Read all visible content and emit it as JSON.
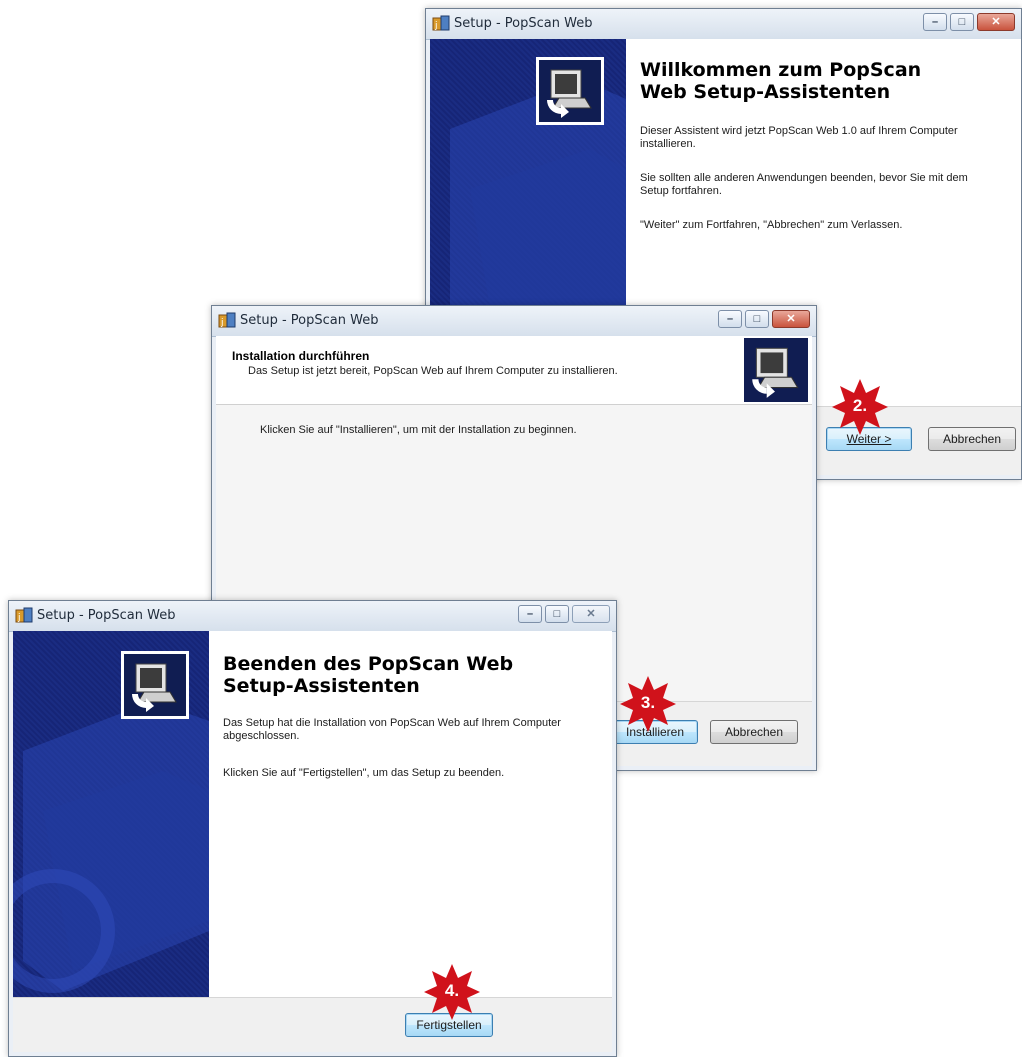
{
  "windows": {
    "welcome": {
      "title": "Setup - PopScan Web",
      "heading": "Willkommen zum PopScan Web Setup-Assistenten",
      "paragraphs": [
        "Dieser Assistent wird jetzt PopScan Web 1.0 auf Ihrem Computer installieren.",
        "Sie sollten alle anderen Anwendungen beenden, bevor Sie mit dem Setup fortfahren.",
        "\"Weiter\" zum Fortfahren, \"Abbrechen\" zum Verlassen."
      ],
      "next_button": "Weiter >",
      "cancel_button": "Abbrechen",
      "step_label": "2."
    },
    "install": {
      "title": "Setup - PopScan Web",
      "header_title": "Installation durchführen",
      "header_subtitle": "Das Setup ist jetzt bereit, PopScan Web auf Ihrem Computer zu installieren.",
      "body": "Klicken Sie auf \"Installieren\", um mit der Installation zu beginnen.",
      "install_button": "Installieren",
      "cancel_button": "Abbrechen",
      "step_label": "3."
    },
    "finish": {
      "title": "Setup - PopScan Web",
      "heading": "Beenden des PopScan Web Setup-Assistenten",
      "paragraphs": [
        "Das Setup hat die Installation von PopScan Web auf Ihrem Computer abgeschlossen.",
        "Klicken Sie auf \"Fertigstellen\", um das Setup zu beenden."
      ],
      "finish_button": "Fertigstellen",
      "step_label": "4."
    }
  },
  "icons": {
    "window_icon": "setup-app-icon",
    "minimize": "minimize-icon",
    "maximize": "maximize-icon",
    "close": "close-icon",
    "wizard": "computer-install-icon",
    "step_marker": "red-star-badge"
  },
  "colors": {
    "banner": "#1a2c82",
    "step_badge": "#d0121b"
  }
}
